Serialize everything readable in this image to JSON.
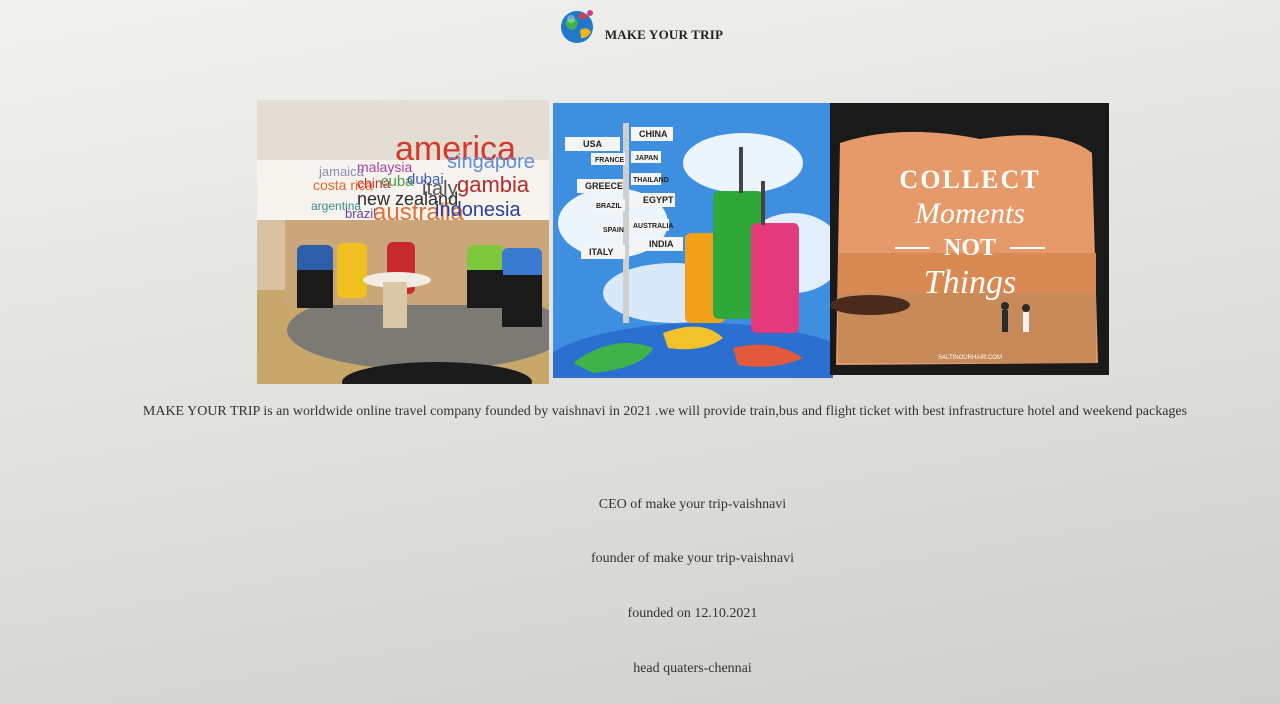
{
  "header": {
    "logo_icon": "globe-icon",
    "title": "MAKE YOUR TRIP"
  },
  "gallery": {
    "photo1": {
      "words": [
        "america",
        "singapore",
        "jamaica",
        "malaysia",
        "costa rica",
        "china",
        "cuba",
        "dubai",
        "new zealand",
        "italy",
        "gambia",
        "argentina",
        "brazil",
        "australia",
        "indonesia"
      ]
    },
    "photo2": {
      "signs": [
        "USA",
        "CHINA",
        "FRANCE",
        "JAPAN",
        "GREECE",
        "THAILAND",
        "BRAZIL",
        "EGYPT",
        "SPAIN",
        "AUSTRALIA",
        "ITALY",
        "INDIA"
      ]
    },
    "photo3": {
      "line1": "COLLECT",
      "line2": "Moments",
      "line3": "NOT",
      "line4": "Things",
      "watermark": "SALTINOURHAIR.COM"
    }
  },
  "content": {
    "description": "MAKE YOUR TRIP is an worldwide online travel company founded by vaishnavi in 2021 .we will provide train,bus and flight ticket with best infrastructure hotel and weekend packages",
    "ceo": "CEO of make your trip-vaishnavi",
    "founder": "founder of make your trip-vaishnavi",
    "founded": "founded on 12.10.2021",
    "headquarters": "head quaters-chennai"
  },
  "colors": {
    "background": "#e4e4e1",
    "text": "#222222"
  }
}
